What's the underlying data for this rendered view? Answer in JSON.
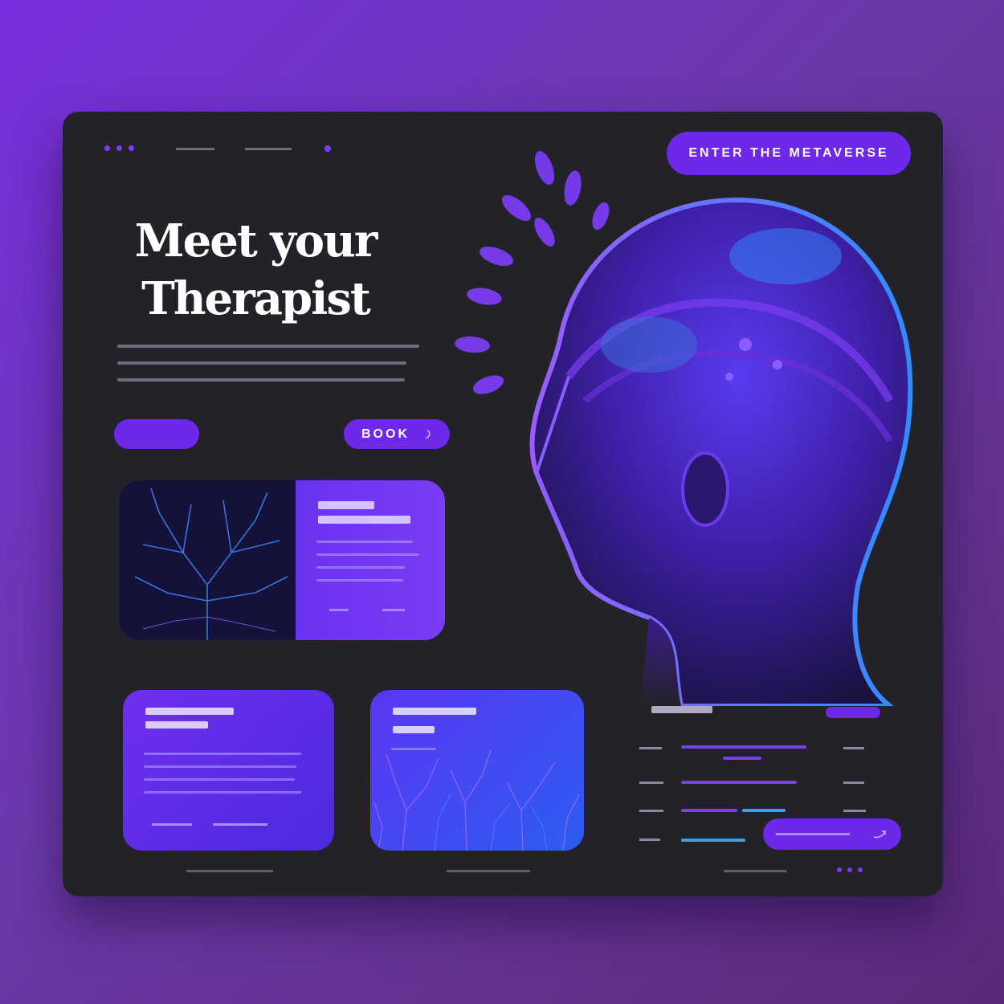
{
  "hero": {
    "cta_label": "ENTER THE METAVERSE",
    "headline_line1": "Meet your",
    "headline_line2": "Therapist",
    "book_label": "BOOK"
  },
  "icons": [
    "window-dots-icon",
    "chevron-icon",
    "arrow-icon"
  ],
  "colors": {
    "accent": "#6d28ea",
    "card_bg": "#232229",
    "page_gradient_start": "#7a2ee0",
    "page_gradient_end": "#5a2a78"
  },
  "progress": {
    "rows": [
      {
        "fill": 0.78,
        "color": "#7b3df2"
      },
      {
        "fill": 0.72,
        "color": "#7b3df2"
      },
      {
        "fill": 0.35,
        "color": "#7b3df2"
      },
      {
        "fill": 0.4,
        "color": "#3aa0f0"
      }
    ]
  }
}
